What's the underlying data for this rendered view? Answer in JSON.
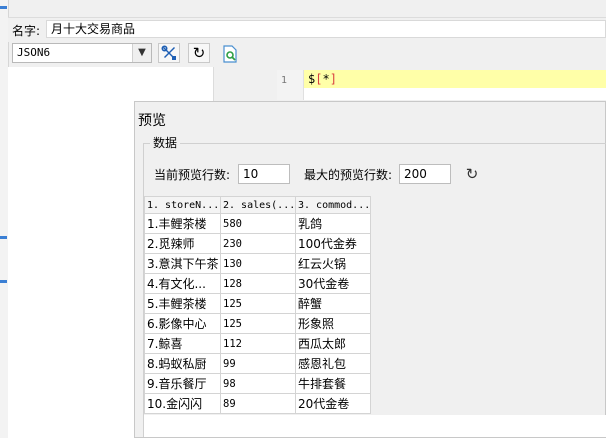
{
  "form": {
    "name_label": "名字:",
    "name_value": "月十大交易商品"
  },
  "toolbar": {
    "type_value": "JSON6",
    "chevron_icon": "chevron-down-icon",
    "tools_icon": "tools-icon",
    "refresh_icon": "refresh-icon",
    "preview_icon": "document-preview-icon"
  },
  "editor": {
    "line_number": "1",
    "code_dollar": "$",
    "code_open": "[",
    "code_star": "*",
    "code_close": "]"
  },
  "dialog": {
    "title": "预览",
    "group_label": "数据",
    "current_rows_label": "当前预览行数:",
    "current_rows_value": "10",
    "max_rows_label": "最大的预览行数:",
    "max_rows_value": "200",
    "refresh_icon": "refresh-icon"
  },
  "table": {
    "headers": [
      "1. storeN...",
      "2. sales(...",
      "3. commod..."
    ],
    "rows": [
      [
        "1.丰鲤茶楼",
        "580",
        "乳鸽"
      ],
      [
        "2.觅辣师",
        "230",
        "100代金券"
      ],
      [
        "3.意淇下午茶",
        "130",
        "红云火锅"
      ],
      [
        "4.有文化...",
        "128",
        "30代金卷"
      ],
      [
        "5.丰鲤茶楼",
        "125",
        "醉蟹"
      ],
      [
        "6.影像中心",
        "125",
        "形象照"
      ],
      [
        "7.鲸喜",
        "112",
        "西瓜太郎"
      ],
      [
        "8.蚂蚁私厨",
        "99",
        "感恩礼包"
      ],
      [
        "9.音乐餐厅",
        "98",
        "牛排套餐"
      ],
      [
        "10.金闪闪",
        "89",
        "20代金卷"
      ]
    ]
  },
  "colors": {
    "code_highlight": "#ffffa8",
    "code_bracket": "#d94040",
    "accent_blue": "#3b7fd4",
    "tools_blue": "#1e5fb4"
  }
}
